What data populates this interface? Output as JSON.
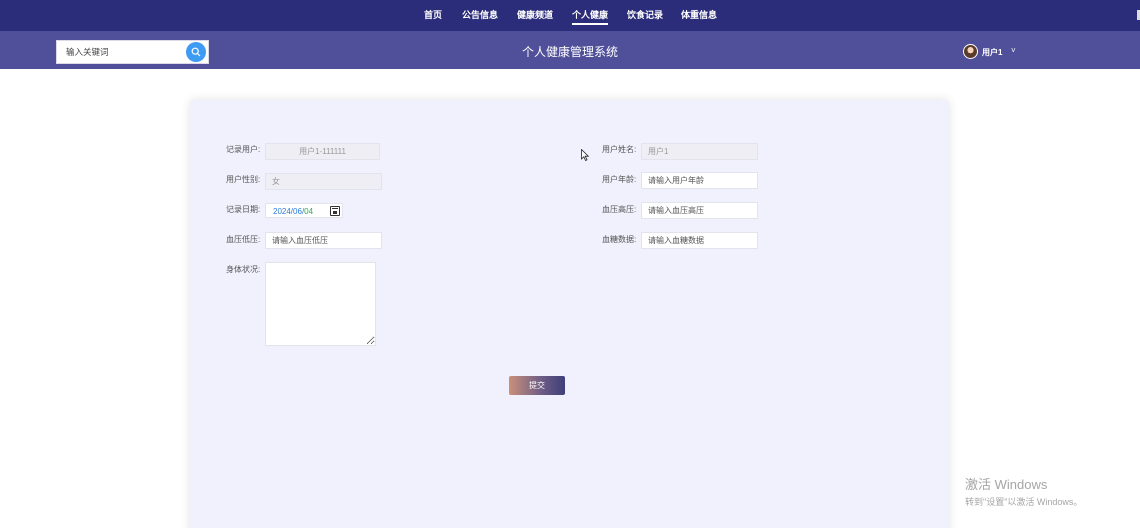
{
  "nav": {
    "items": [
      {
        "label": "首页",
        "active": false
      },
      {
        "label": "公告信息",
        "active": false
      },
      {
        "label": "健康频道",
        "active": false
      },
      {
        "label": "个人健康",
        "active": true
      },
      {
        "label": "饮食记录",
        "active": false
      },
      {
        "label": "体重信息",
        "active": false
      }
    ]
  },
  "header": {
    "search_placeholder": "输入关键词",
    "site_title": "个人健康管理系统",
    "user_name": "用户1",
    "caret": "˅"
  },
  "form": {
    "record_user": {
      "label": "记录用户:",
      "value": "用户1-111111"
    },
    "user_name": {
      "label": "用户姓名:",
      "value": "用户1"
    },
    "gender": {
      "label": "用户性别:",
      "value": "女"
    },
    "age": {
      "label": "用户年龄:",
      "placeholder": "请输入用户年龄"
    },
    "record_date": {
      "label": "记录日期:",
      "year": "2024",
      "month": "06",
      "day": "04",
      "sep": "/"
    },
    "bp_high": {
      "label": "血压高压:",
      "placeholder": "请输入血压高压"
    },
    "bp_low": {
      "label": "血压低压:",
      "placeholder": "请输入血压低压"
    },
    "blood_sugar": {
      "label": "血糖数据:",
      "placeholder": "请输入血糖数据"
    },
    "body_status": {
      "label": "身体状况:",
      "value": ""
    },
    "submit_label": "提交"
  },
  "watermark": {
    "title": "激活 Windows",
    "subtitle": "转到\"设置\"以激活 Windows。"
  },
  "colors": {
    "topnav_bg": "#2c2d7a",
    "header_bg": "#4f4f9a",
    "card_bg": "#f1f0fd",
    "search_button": "#3d9bf4"
  }
}
